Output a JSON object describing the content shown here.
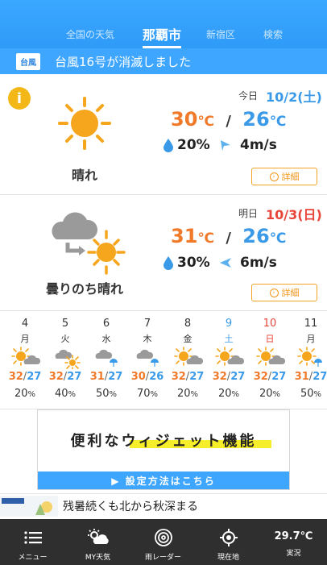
{
  "header": {
    "tabs": [
      {
        "label": "全国の天気"
      },
      {
        "label": "那覇市"
      },
      {
        "label": "新宿区"
      },
      {
        "label": "検索"
      }
    ]
  },
  "notice": {
    "badge": "台風",
    "text": "台風16号が消滅しました"
  },
  "today": {
    "day_label": "今日",
    "date": "10/2(土)",
    "weather": "晴れ",
    "high": "30",
    "low": "26",
    "unit": "℃",
    "rain": "20%",
    "wind": "4m/s",
    "detail_label": "詳細",
    "info_icon": "i"
  },
  "tomorrow": {
    "day_label": "明日",
    "date": "10/3(日)",
    "weather": "曇りのち晴れ",
    "high": "31",
    "low": "26",
    "unit": "℃",
    "rain": "30%",
    "wind": "6m/s",
    "detail_label": "詳細"
  },
  "forecast": [
    {
      "day": "4",
      "wd": "月",
      "icon": "sun-cloud",
      "high": "32",
      "low": "27",
      "rain": "20",
      "color": "#333"
    },
    {
      "day": "5",
      "wd": "火",
      "icon": "cloud-sun",
      "high": "32",
      "low": "27",
      "rain": "40",
      "color": "#333"
    },
    {
      "day": "6",
      "wd": "水",
      "icon": "cloud-rain",
      "high": "31",
      "low": "27",
      "rain": "50",
      "color": "#333"
    },
    {
      "day": "7",
      "wd": "木",
      "icon": "cloud-rain",
      "high": "30",
      "low": "26",
      "rain": "70",
      "color": "#333"
    },
    {
      "day": "8",
      "wd": "金",
      "icon": "sun-cloud",
      "high": "32",
      "low": "27",
      "rain": "20",
      "color": "#333"
    },
    {
      "day": "9",
      "wd": "土",
      "icon": "sun-cloud",
      "high": "32",
      "low": "27",
      "rain": "20",
      "color": "#3a9ae8"
    },
    {
      "day": "10",
      "wd": "日",
      "icon": "sun-cloud",
      "high": "32",
      "low": "27",
      "rain": "20",
      "color": "#e8443a"
    },
    {
      "day": "11",
      "wd": "月",
      "icon": "sun-rain",
      "high": "31",
      "low": "27",
      "rain": "50",
      "color": "#333"
    }
  ],
  "forecast_unit": "%",
  "ad": {
    "title": "便利なウィジェット機能",
    "link": "▶ 設定方法はこちら"
  },
  "news": {
    "text": "残暑続くも北から秋深まる"
  },
  "bottom_nav": [
    {
      "label": "メニュー",
      "icon": "menu-icon"
    },
    {
      "label": "MY天気",
      "icon": "my-weather-icon"
    },
    {
      "label": "雨レーダー",
      "icon": "radar-icon"
    },
    {
      "label": "現在地",
      "icon": "location-icon"
    },
    {
      "label": "実況",
      "icon": "",
      "value": "29.7℃"
    }
  ],
  "colors": {
    "header": "#3aa7ff",
    "high": "#f07a2a",
    "low": "#3a9ae8",
    "accent": "#f39417"
  }
}
